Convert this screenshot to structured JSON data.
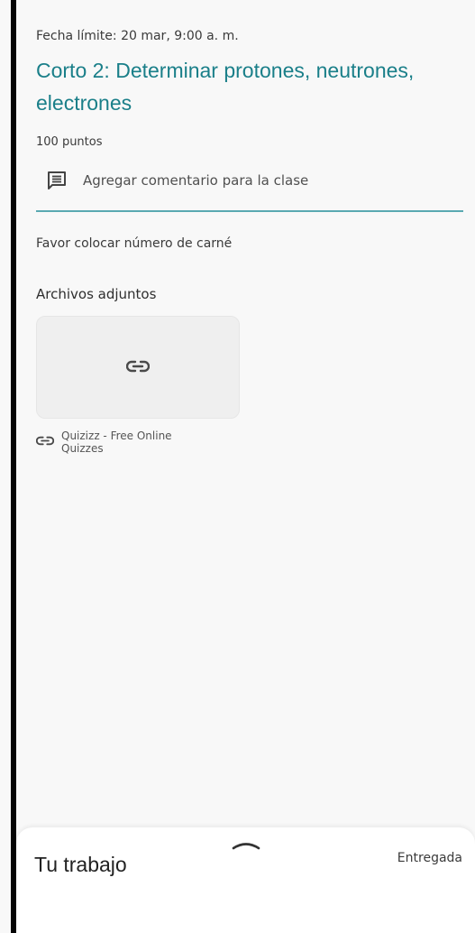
{
  "assignment": {
    "due_date": "Fecha límite: 20 mar, 9:00 a. m.",
    "title": "Corto 2: Determinar protones, neutrones, electrones",
    "points": "100 puntos",
    "comment_button_label": "Agregar comentario para la clase",
    "instructions": "Favor colocar número de carné"
  },
  "attachments": {
    "heading": "Archivos adjuntos",
    "items": [
      {
        "name": "Quizizz - Free Online Quizzes",
        "icon": "link-icon"
      }
    ]
  },
  "bottom_sheet": {
    "title": "Tu trabajo",
    "status": "Entregada",
    "handle_icon": "chevron-up-icon"
  },
  "colors": {
    "title": "#1a7f89",
    "divider": "#5aa9b1",
    "border_bar": "#050505"
  }
}
